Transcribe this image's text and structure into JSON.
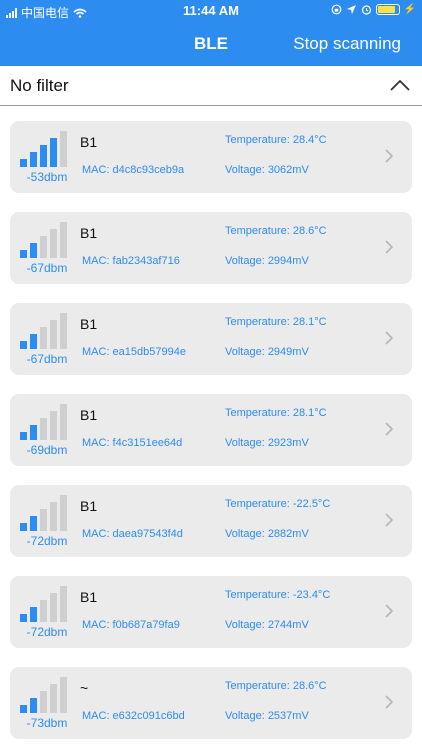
{
  "status_bar": {
    "carrier": "中国电信",
    "time": "11:44 AM",
    "icons": [
      "cellular-signal-icon",
      "wifi-icon",
      "orientation-lock-icon",
      "location-icon",
      "alarm-icon",
      "battery-icon",
      "charging-icon"
    ],
    "battery_level": 0.85,
    "battery_color": "#ffe14a"
  },
  "header": {
    "title": "BLE",
    "stop_label": "Stop scanning",
    "background": "#2d8cf0"
  },
  "filter": {
    "label": "No filter",
    "icon": "chevron-up-icon"
  },
  "colors": {
    "accent": "#2d8cf0",
    "card_background": "#ebebeb",
    "bar_inactive": "#cfcfcf"
  },
  "devices": [
    {
      "name": "B1",
      "rssi": "-53dbm",
      "signal_level": 4,
      "mac": "MAC: d4c8c93ceb9a",
      "temperature": "Temperature: 28.4°C",
      "voltage": "Voltage: 3062mV"
    },
    {
      "name": "B1",
      "rssi": "-67dbm",
      "signal_level": 2,
      "mac": "MAC: fab2343af716",
      "temperature": "Temperature: 28.6°C",
      "voltage": "Voltage: 2994mV"
    },
    {
      "name": "B1",
      "rssi": "-67dbm",
      "signal_level": 2,
      "mac": "MAC: ea15db57994e",
      "temperature": "Temperature: 28.1°C",
      "voltage": "Voltage: 2949mV"
    },
    {
      "name": "B1",
      "rssi": "-69dbm",
      "signal_level": 2,
      "mac": "MAC: f4c3151ee64d",
      "temperature": "Temperature: 28.1°C",
      "voltage": "Voltage: 2923mV"
    },
    {
      "name": "B1",
      "rssi": "-72dbm",
      "signal_level": 2,
      "mac": "MAC: daea97543f4d",
      "temperature": "Temperature: -22.5°C",
      "voltage": "Voltage: 2882mV"
    },
    {
      "name": "B1",
      "rssi": "-72dbm",
      "signal_level": 2,
      "mac": "MAC: f0b687a79fa9",
      "temperature": "Temperature: -23.4°C",
      "voltage": "Voltage: 2744mV"
    },
    {
      "name": "~",
      "rssi": "-73dbm",
      "signal_level": 2,
      "mac": "MAC: e632c091c6bd",
      "temperature": "Temperature: 28.6°C",
      "voltage": "Voltage: 2537mV"
    }
  ]
}
